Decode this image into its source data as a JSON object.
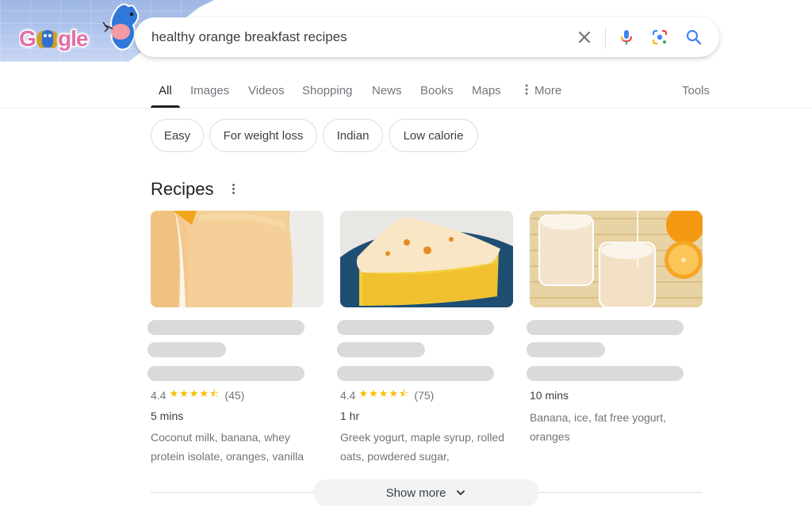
{
  "doodle": {
    "logo_text": "Google",
    "icon": "google-doodle-logo"
  },
  "search": {
    "query": "healthy orange breakfast recipes",
    "icons": [
      "clear-icon",
      "microphone-icon",
      "google-lens-icon",
      "search-icon"
    ]
  },
  "tabs": [
    {
      "label": "All",
      "active": true
    },
    {
      "label": "Images"
    },
    {
      "label": "Videos"
    },
    {
      "label": "Shopping"
    },
    {
      "label": "News"
    },
    {
      "label": "Books"
    },
    {
      "label": "Maps"
    },
    {
      "label": "More",
      "icon": "more-vert-icon"
    }
  ],
  "tools_label": "Tools",
  "chips": [
    "Easy",
    "For weight loss",
    "Indian",
    "Low calorie"
  ],
  "recipes": {
    "title": "Recipes",
    "cards": [
      {
        "image": "orange-smoothie-photo",
        "rating": "4.4",
        "stars": "★★★★⯪",
        "rating_value": 4.4,
        "reviews": "(45)",
        "time": "5 mins",
        "ingredients": "Coconut milk, banana, whey protein isolate, oranges, vanilla"
      },
      {
        "image": "orange-cake-photo",
        "rating": "4.4",
        "stars": "★★★★⯪",
        "rating_value": 4.4,
        "reviews": "(75)",
        "time": "1 hr",
        "ingredients": "Greek yogurt, maple syrup, rolled oats, powdered sugar,"
      },
      {
        "image": "orange-milkshake-photo",
        "time": "10 mins",
        "ingredients": "Banana, ice, fat free yogurt, oranges"
      }
    ]
  },
  "show_more_label": "Show more",
  "colors": {
    "star": "#fbbc04",
    "accent_blue": "#4285f4",
    "mic_red": "#ea4335",
    "text_primary": "#202124",
    "text_secondary": "#70757a"
  }
}
